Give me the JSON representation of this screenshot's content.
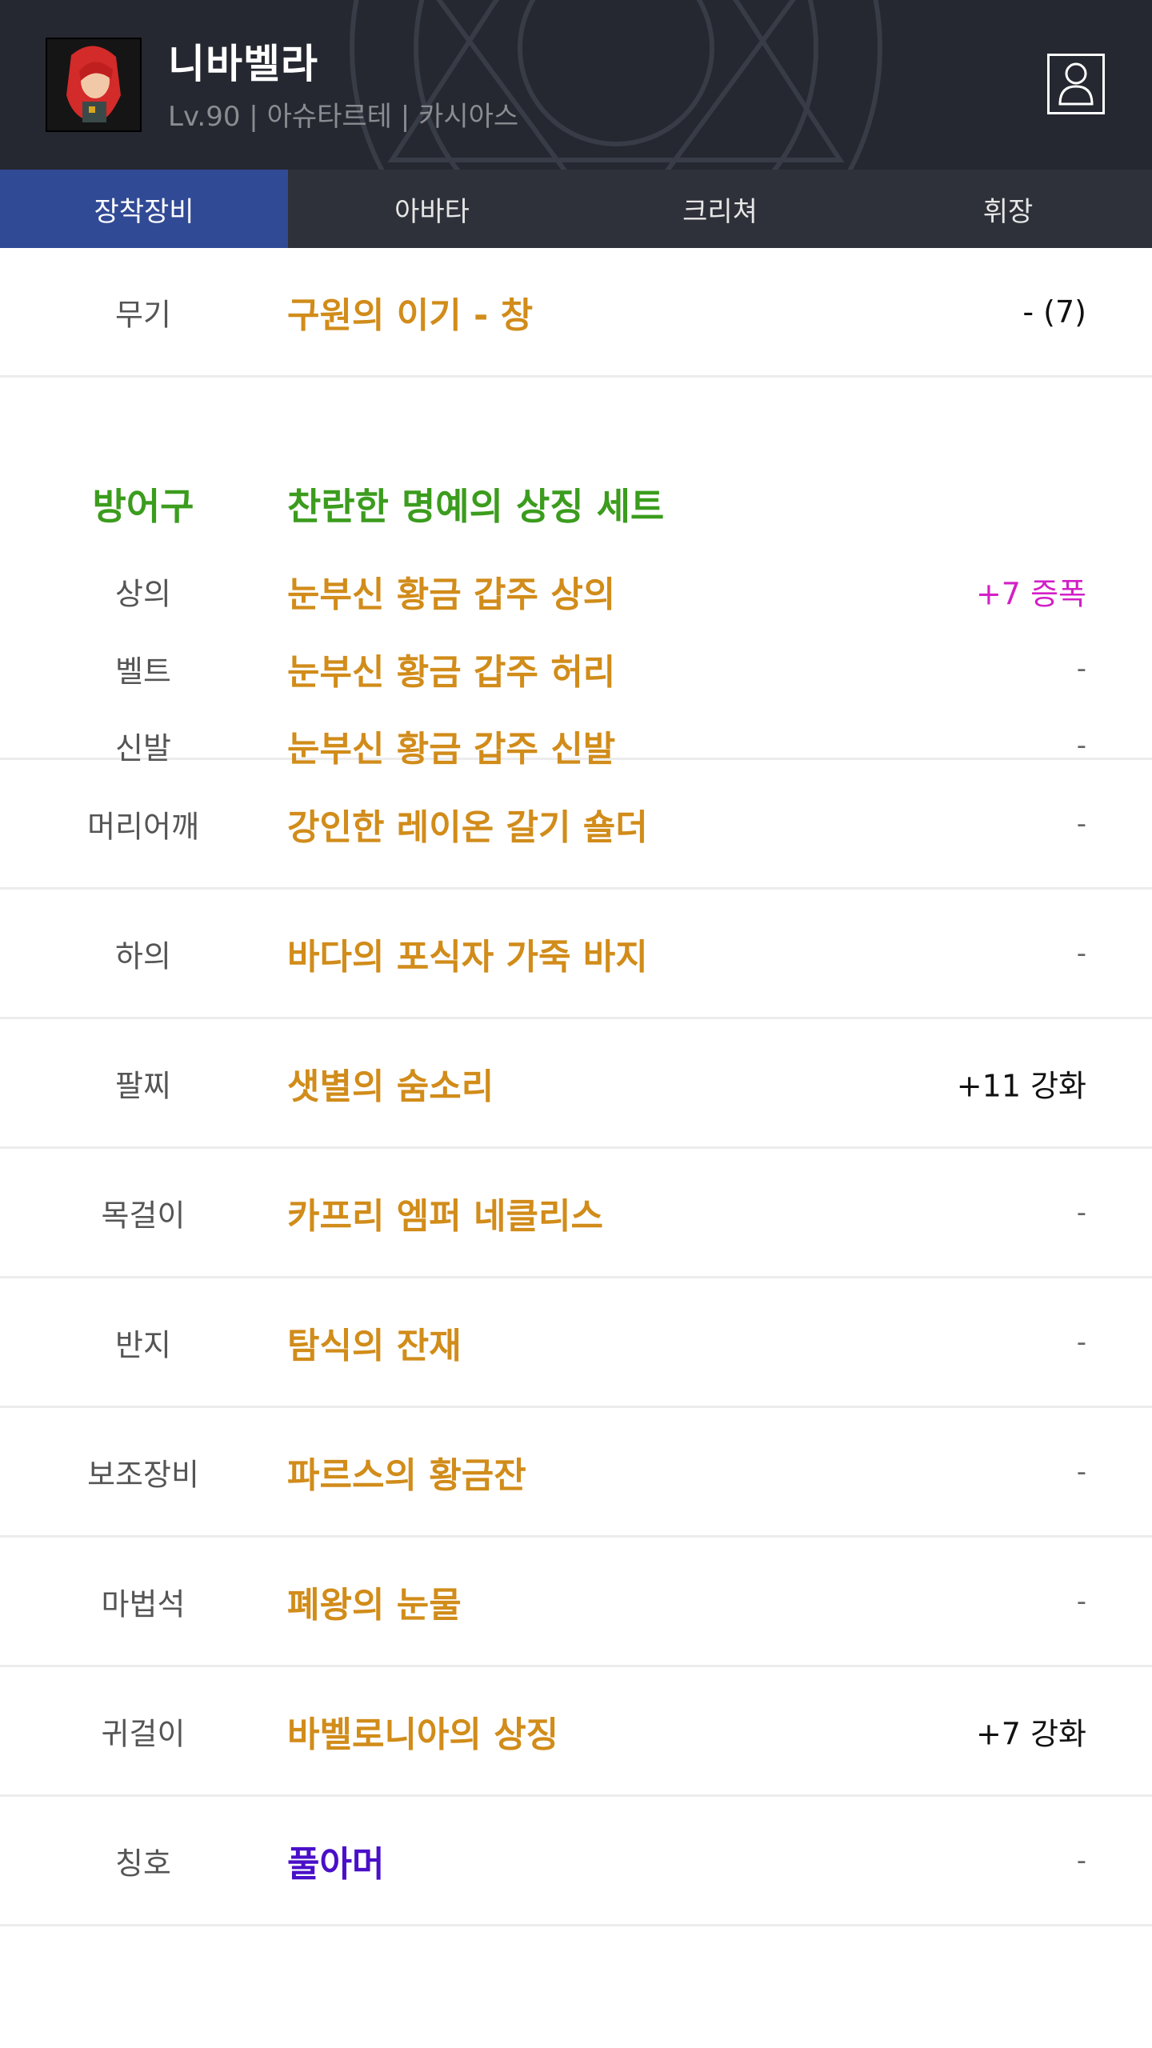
{
  "header": {
    "name": "니바벨라",
    "info": "Lv.90 | 아슈타르테 | 카시아스",
    "profile_icon": "person-icon"
  },
  "tabs": [
    "장착장비",
    "아바타",
    "크리쳐",
    "휘장"
  ],
  "active_tab": 0,
  "weapon": {
    "slot": "무기",
    "item": "구원의 이기 - 창",
    "value": "- (7)"
  },
  "armor": {
    "label": "방어구",
    "set_name": "찬란한 명예의 상징 세트",
    "items": [
      {
        "slot": "상의",
        "item": "눈부신 황금 갑주 상의",
        "value": "+7 증폭"
      },
      {
        "slot": "벨트",
        "item": "눈부신 황금 갑주 허리",
        "value": "-"
      },
      {
        "slot": "신발",
        "item": "눈부신 황금 갑주 신발",
        "value": "-"
      }
    ]
  },
  "rows": [
    {
      "slot": "머리어깨",
      "item": "강인한 레이온 갈기 숄더",
      "value": "-"
    },
    {
      "slot": "하의",
      "item": "바다의 포식자 가죽 바지",
      "value": "-"
    },
    {
      "slot": "팔찌",
      "item": "샛별의 숨소리",
      "value": "+11 강화"
    },
    {
      "slot": "목걸이",
      "item": "카프리 엠퍼 네클리스",
      "value": "-"
    },
    {
      "slot": "반지",
      "item": "탐식의 잔재",
      "value": "-"
    },
    {
      "slot": "보조장비",
      "item": "파르스의 황금잔",
      "value": "-"
    },
    {
      "slot": "마법석",
      "item": "폐왕의 눈물",
      "value": "-"
    },
    {
      "slot": "귀걸이",
      "item": "바벨로니아의 상징",
      "value": "+7 강화"
    },
    {
      "slot": "칭호",
      "item": "풀아머",
      "value": "-"
    }
  ],
  "colors": {
    "header_bg": "#252830",
    "tab_active": "#314a95",
    "item_gold": "#d18c1a",
    "set_green": "#3b9c1d",
    "amplify_magenta": "#d21fc7",
    "title_purple": "#4a0fc8"
  }
}
